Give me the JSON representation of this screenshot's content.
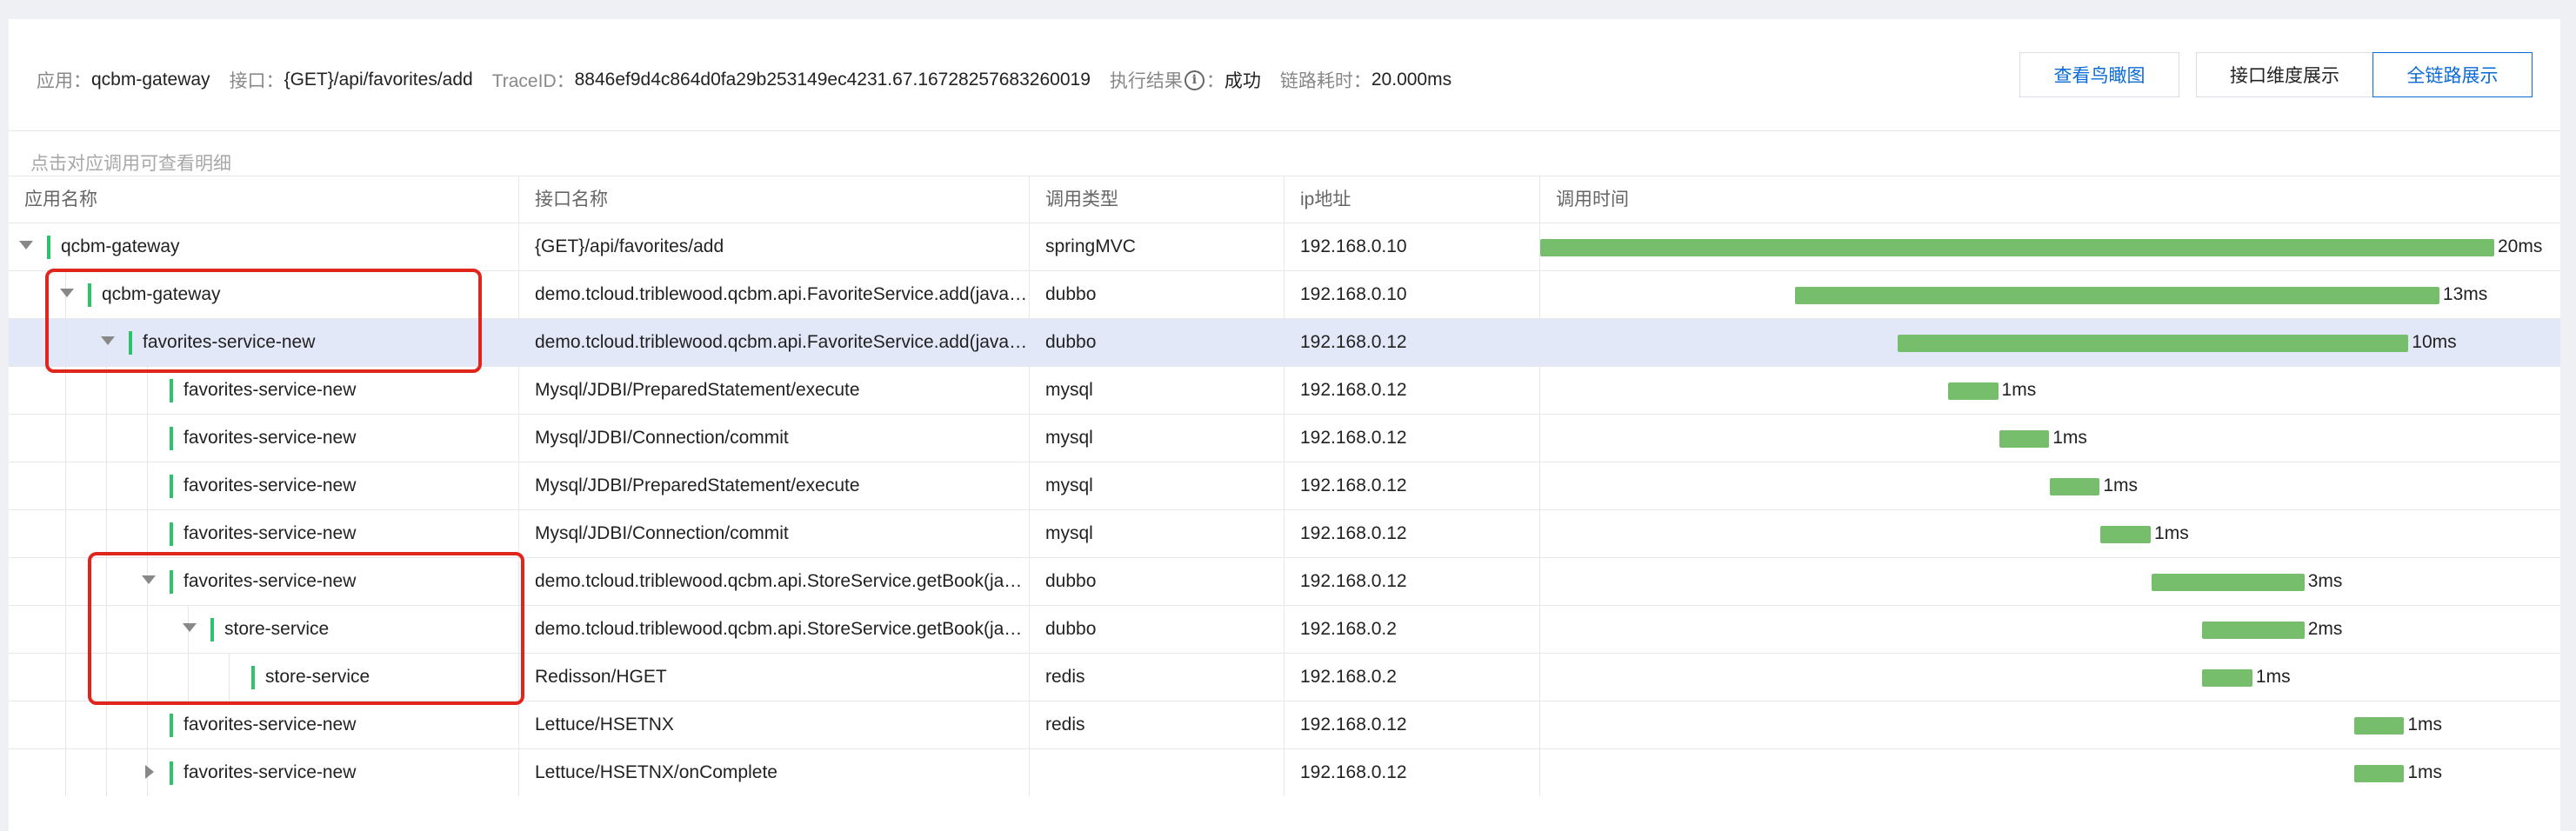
{
  "header": {
    "app_label": "应用：",
    "app_value": "qcbm-gateway",
    "api_label": "接口：",
    "api_value": "{GET}/api/favorites/add",
    "trace_label": "TraceID：",
    "trace_value": "8846ef9d4c864d0fa29b253149ec4231.67.16728257683260019",
    "result_label": "执行结果",
    "result_colon": "：",
    "result_value": "成功",
    "duration_label": "链路耗时：",
    "duration_value": "20.000ms",
    "btn_overview": "查看鸟瞰图",
    "btn_interface_view": "接口维度展示",
    "btn_full_trace": "全链路展示"
  },
  "hint": "点击对应调用可查看明细",
  "columns": [
    "应用名称",
    "接口名称",
    "调用类型",
    "ip地址",
    "调用时间"
  ],
  "rows": [
    {
      "app": "qcbm-gateway",
      "api": "{GET}/api/favorites/add",
      "type": "springMVC",
      "ip": "192.168.0.10",
      "duration": "20ms",
      "start_ms": 0,
      "dur_ms": 20,
      "depth": 0,
      "caret": "down"
    },
    {
      "app": "qcbm-gateway",
      "api": "demo.tcloud.triblewood.qcbm.api.FavoriteService.add(java.lang.Long, java.lang.Long)",
      "type": "dubbo",
      "ip": "192.168.0.10",
      "duration": "13ms",
      "start_ms": 5.35,
      "dur_ms": 13.5,
      "depth": 1,
      "caret": "down"
    },
    {
      "app": "favorites-service-new",
      "api": "demo.tcloud.triblewood.qcbm.api.FavoriteService.add(java.lang.Long, java.lang.Long)",
      "type": "dubbo",
      "ip": "192.168.0.12",
      "duration": "10ms",
      "start_ms": 7.5,
      "dur_ms": 10.7,
      "depth": 2,
      "caret": "down"
    },
    {
      "app": "favorites-service-new",
      "api": "Mysql/JDBI/PreparedStatement/execute",
      "type": "mysql",
      "ip": "192.168.0.12",
      "duration": "1ms",
      "start_ms": 8.55,
      "dur_ms": 1.05,
      "depth": 3,
      "caret": ""
    },
    {
      "app": "favorites-service-new",
      "api": "Mysql/JDBI/Connection/commit",
      "type": "mysql",
      "ip": "192.168.0.12",
      "duration": "1ms",
      "start_ms": 9.62,
      "dur_ms": 1.05,
      "depth": 3,
      "caret": ""
    },
    {
      "app": "favorites-service-new",
      "api": "Mysql/JDBI/PreparedStatement/execute",
      "type": "mysql",
      "ip": "192.168.0.12",
      "duration": "1ms",
      "start_ms": 10.68,
      "dur_ms": 1.05,
      "depth": 3,
      "caret": ""
    },
    {
      "app": "favorites-service-new",
      "api": "Mysql/JDBI/Connection/commit",
      "type": "mysql",
      "ip": "192.168.0.12",
      "duration": "1ms",
      "start_ms": 11.75,
      "dur_ms": 1.05,
      "depth": 3,
      "caret": ""
    },
    {
      "app": "favorites-service-new",
      "api": "demo.tcloud.triblewood.qcbm.api.StoreService.getBook(java.lang.Long)",
      "type": "dubbo",
      "ip": "192.168.0.12",
      "duration": "3ms",
      "start_ms": 12.82,
      "dur_ms": 3.2,
      "depth": 3,
      "caret": "down"
    },
    {
      "app": "store-service",
      "api": "demo.tcloud.triblewood.qcbm.api.StoreService.getBook(java.lang.Long)",
      "type": "dubbo",
      "ip": "192.168.0.2",
      "duration": "2ms",
      "start_ms": 13.88,
      "dur_ms": 2.14,
      "depth": 4,
      "caret": "down"
    },
    {
      "app": "store-service",
      "api": "Redisson/HGET",
      "type": "redis",
      "ip": "192.168.0.2",
      "duration": "1ms",
      "start_ms": 13.88,
      "dur_ms": 1.05,
      "depth": 5,
      "caret": ""
    },
    {
      "app": "favorites-service-new",
      "api": "Lettuce/HSETNX",
      "type": "redis",
      "ip": "192.168.0.12",
      "duration": "1ms",
      "start_ms": 17.06,
      "dur_ms": 1.05,
      "depth": 3,
      "caret": ""
    },
    {
      "app": "favorites-service-new",
      "api": "Lettuce/HSETNX/onComplete",
      "type": "",
      "ip": "192.168.0.12",
      "duration": "1ms",
      "start_ms": 17.06,
      "dur_ms": 1.05,
      "depth": 3,
      "caret": "right"
    }
  ],
  "selected_row": 2,
  "colors": {
    "bar": "#76be6c",
    "indicator": "#2cc36b",
    "selected_bg": "#e3e8f8",
    "highlight": "#e0261c",
    "link": "#0a6bd6"
  }
}
